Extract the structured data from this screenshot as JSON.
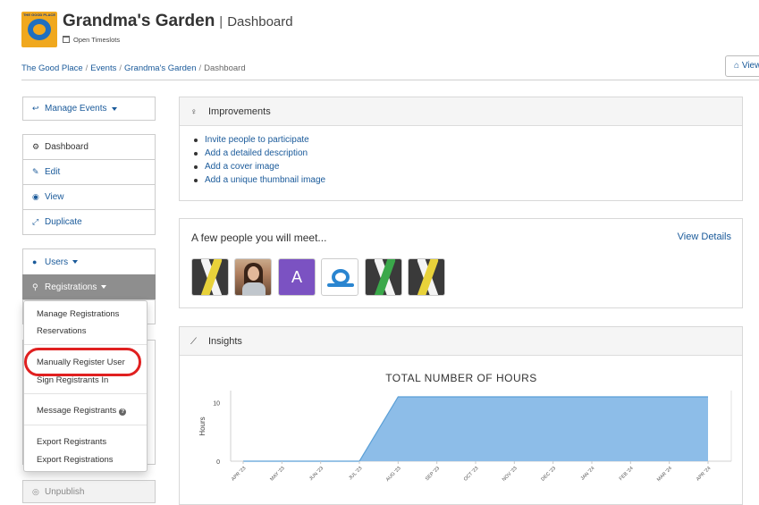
{
  "header": {
    "logo_text": "THE GOOD PLACE",
    "title": "Grandma's Garden",
    "separator": "|",
    "subtitle": "Dashboard",
    "timeslots": "Open Timeslots",
    "view_button": "View"
  },
  "breadcrumb": [
    {
      "label": "The Good Place"
    },
    {
      "label": "Events"
    },
    {
      "label": "Grandma's Garden"
    },
    {
      "label": "Dashboard"
    }
  ],
  "sidebar": {
    "manage_events": "Manage Events",
    "dashboard": "Dashboard",
    "edit": "Edit",
    "view": "View",
    "duplicate": "Duplicate",
    "users": "Users",
    "registrations": "Registrations",
    "unpublish": "Unpublish"
  },
  "registrations_menu": {
    "manage": "Manage Registrations",
    "reservations": "Reservations",
    "manually_register": "Manually Register User",
    "sign_in": "Sign Registrants In",
    "message": "Message Registrants",
    "export_registrants": "Export Registrants",
    "export_registrations": "Export Registrations"
  },
  "improvements": {
    "title": "Improvements",
    "items": [
      "Invite people to participate",
      "Add a detailed description",
      "Add a cover image",
      "Add a unique thumbnail image"
    ]
  },
  "meet": {
    "title": "A few people you will meet...",
    "link": "View Details",
    "avatar_letter": "A"
  },
  "insights": {
    "title": "Insights"
  },
  "colors": {
    "link": "#1a5a9a",
    "highlight": "#e02020",
    "chart_fill": "#8dbde8",
    "chart_line": "#5a9fd6",
    "active_nav": "#8e8e8e"
  },
  "chart_data": {
    "type": "area",
    "title": "TOTAL NUMBER OF HOURS",
    "ylabel": "Hours",
    "xlabel": "",
    "categories": [
      "APR '23",
      "MAY '23",
      "JUN '23",
      "JUL '23",
      "AUG '23",
      "SEP '23",
      "OCT '23",
      "NOV '23",
      "DEC '23",
      "JAN '24",
      "FEB '24",
      "MAR '24",
      "APR '24"
    ],
    "values": [
      0,
      0,
      0,
      0,
      11,
      11,
      11,
      11,
      11,
      11,
      11,
      11,
      11
    ],
    "ylim": [
      0,
      11
    ],
    "yticks": [
      0,
      10
    ]
  }
}
